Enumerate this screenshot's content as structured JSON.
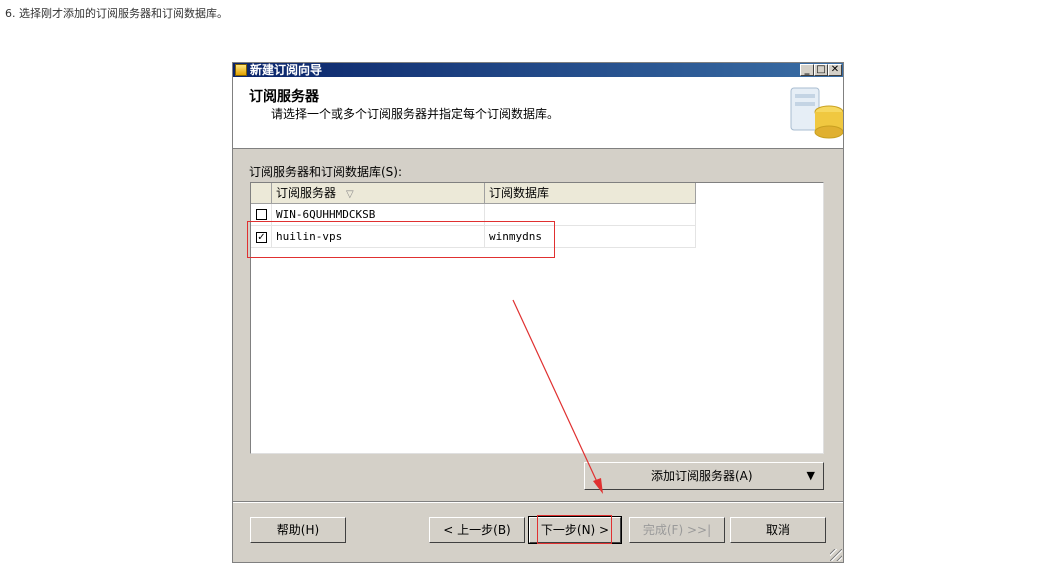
{
  "caption": "6. 选择刚才添加的订阅服务器和订阅数据库。",
  "window": {
    "title": "新建订阅向导",
    "controls": {
      "minimize": "_",
      "maximize": "□",
      "close": "✕"
    }
  },
  "header": {
    "title": "订阅服务器",
    "subtitle": "请选择一个或多个订阅服务器并指定每个订阅数据库。"
  },
  "list": {
    "label": "订阅服务器和订阅数据库(S):",
    "columns": [
      "订阅服务器",
      "订阅数据库"
    ],
    "sort_indicator": "▽",
    "rows": [
      {
        "checked": false,
        "check_glyph": "",
        "server": "WIN-6QUHHMDCKSB",
        "database": ""
      },
      {
        "checked": true,
        "check_glyph": "✓",
        "server": "huilin-vps",
        "database": "winmydns"
      }
    ]
  },
  "add_button": {
    "label": "添加订阅服务器(A)",
    "dropdown_glyph": "▼"
  },
  "buttons": {
    "help": "帮助(H)",
    "back": "< 上一步(B)",
    "next": "下一步(N) >",
    "finish": "完成(F) >>|",
    "cancel": "取消"
  },
  "colors": {
    "title_bar_start": "#0a246a",
    "title_bar_end": "#3a6ea5",
    "dialog_bg": "#d4d0c8",
    "annotation": "#e03030"
  }
}
